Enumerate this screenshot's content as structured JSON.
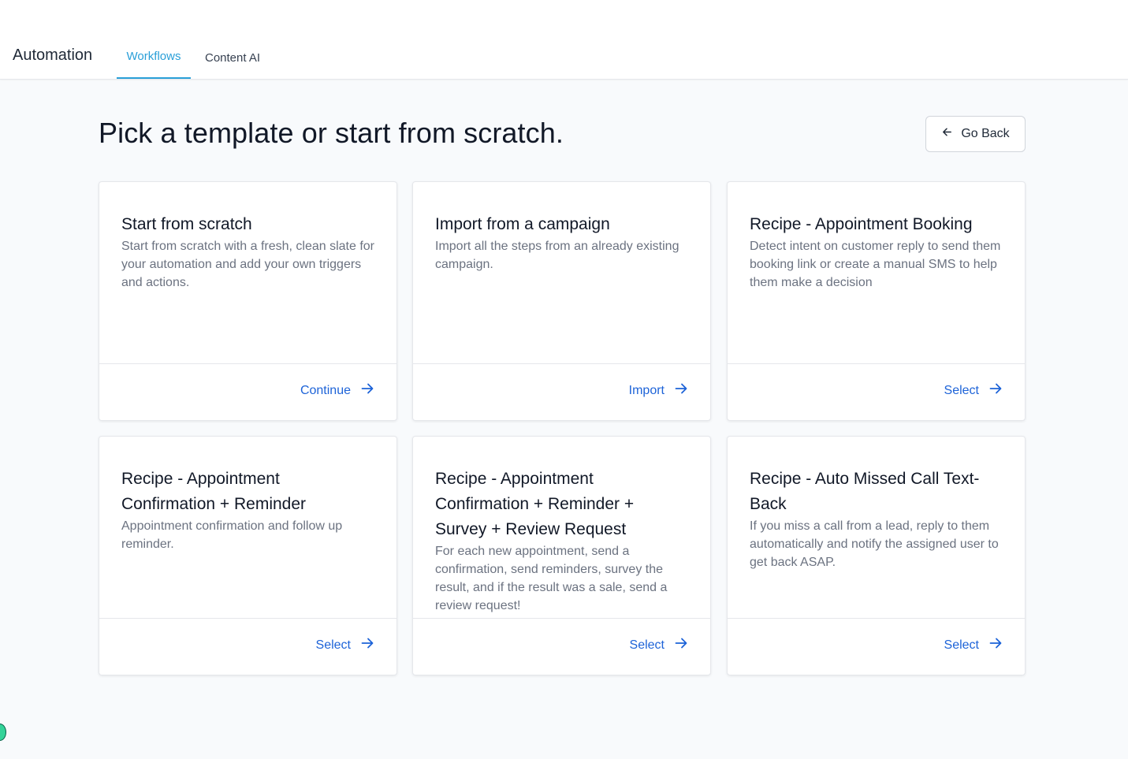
{
  "header": {
    "app_title": "Automation",
    "tabs": [
      {
        "label": "Workflows",
        "active": true
      },
      {
        "label": "Content AI",
        "active": false
      }
    ]
  },
  "main": {
    "title": "Pick a template or start from scratch.",
    "go_back_label": "Go Back",
    "cards": [
      {
        "title": "Start from scratch",
        "description": "Start from scratch with a fresh, clean slate for your automation and add your own triggers and actions.",
        "action": "Continue"
      },
      {
        "title": "Import from a campaign",
        "description": "Import all the steps from an already existing campaign.",
        "action": "Import"
      },
      {
        "title": "Recipe - Appointment Booking",
        "description": "Detect intent on customer reply to send them booking link or create a manual SMS to help them make a decision",
        "action": "Select"
      },
      {
        "title": "Recipe - Appointment Confirmation + Reminder",
        "description": "Appointment confirmation and follow up reminder.",
        "action": "Select"
      },
      {
        "title": "Recipe - Appointment Confirmation + Reminder + Survey + Review Request",
        "description": "For each new appointment, send a confirmation, send reminders, survey the result, and if the result was a sale, send a review request!",
        "action": "Select"
      },
      {
        "title": "Recipe - Auto Missed Call Text-Back",
        "description": "If you miss a call from a lead, reply to them automatically and notify the assigned user to get back ASAP.",
        "action": "Select"
      }
    ]
  },
  "colors": {
    "accent_tab": "#2a9fd8",
    "action_link": "#1d63d8",
    "background": "#f8fafc"
  },
  "icons": {
    "go_back": "arrow-left-icon",
    "card_action": "arrow-right-icon"
  }
}
